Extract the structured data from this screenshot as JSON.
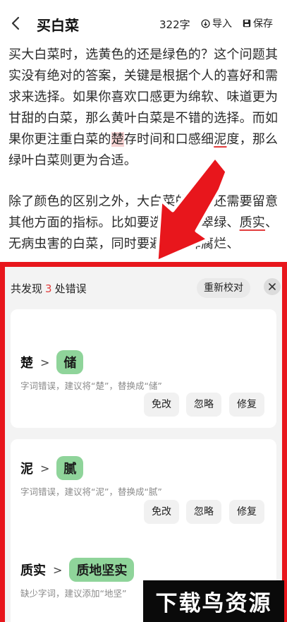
{
  "header": {
    "title": "买白菜",
    "word_count": "322字",
    "import_label": "导入",
    "save_label": "保存"
  },
  "article": {
    "p1_a": "买大白菜时，选黄色的还是绿色的？这个问题其实没有绝对的答案，关键是根据个人的喜好和需求来选择。如果你喜欢口感更为绵软、味道更为甘甜的白菜，那么黄叶白菜是不错的选择。而如果你更注重白菜的",
    "p1_err1": "楚",
    "p1_b": "存时间和口感细",
    "p1_err2": "泥",
    "p1_c": "度，那么绿叶白菜则更为合适。",
    "p2_a": "除了颜色的区别之外，大白菜的选购还需要留意其他方面的指标。比如要选择叶片翠绿、",
    "p2_err": "质实",
    "p2_b": "、无病虫害的白菜，同时要避免选择腐烂、"
  },
  "panel": {
    "summary_prefix": "共发现",
    "error_count": "3",
    "summary_suffix": "处错误",
    "recheck_label": "重新校对",
    "suggestions": [
      {
        "original": "楚",
        "replacement": "储",
        "description": "字词错误，建议将“楚”，替换成“储”",
        "exempt_label": "免改",
        "ignore_label": "忽略",
        "fix_label": "修复"
      },
      {
        "original": "泥",
        "replacement": "腻",
        "description": "字词错误，建议将“泥”，替换成“腻”",
        "exempt_label": "免改",
        "ignore_label": "忽略",
        "fix_label": "修复"
      },
      {
        "original": "质实",
        "replacement": "质地坚实",
        "description": "缺少字词，建议添加“地坚”"
      }
    ]
  },
  "watermark": {
    "text": "下载鸟资源"
  },
  "colors": {
    "accent_red": "#e8161c",
    "replacement_green": "#8fd49a",
    "error_highlight": "#f7d3d3"
  }
}
